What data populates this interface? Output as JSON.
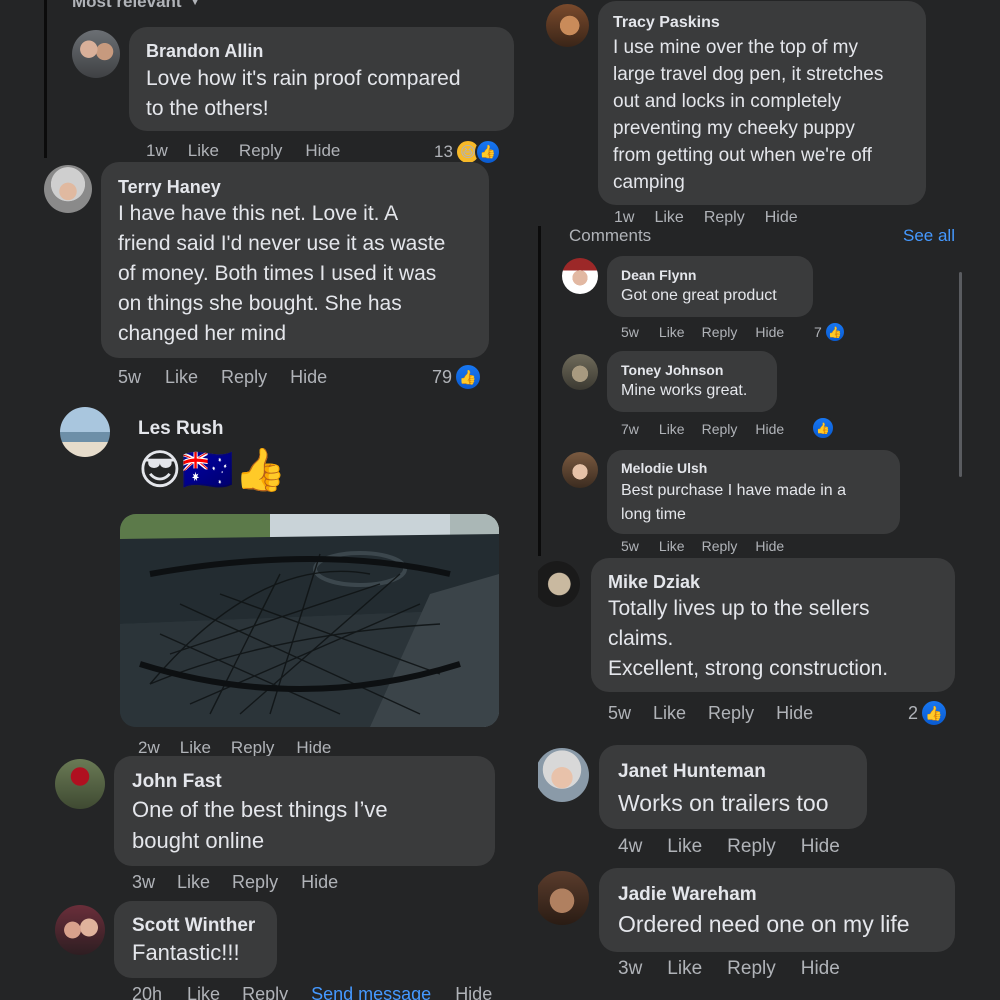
{
  "sort": {
    "label": "Most relevant"
  },
  "left": [
    {
      "name": "Brandon Allin",
      "text": "Love how it's rain proof compared\nto the others!",
      "time": "1w",
      "like": "Like",
      "reply": "Reply",
      "hide": "Hide",
      "count": "13"
    },
    {
      "name": "Terry Haney",
      "text": "I have have this net. Love it. A\nfriend said I'd never use it as waste\nof money. Both times I used it was\non things she bought. She has\nchanged her mind",
      "time": "5w",
      "like": "Like",
      "reply": "Reply",
      "hide": "Hide",
      "count": "79"
    },
    {
      "name": "Les Rush",
      "emojis": "😎🇦🇺👍",
      "time": "2w",
      "like": "Like",
      "reply": "Reply",
      "hide": "Hide"
    },
    {
      "name": "John Fast",
      "text": "One of the best things I’ve\nbought online",
      "time": "3w",
      "like": "Like",
      "reply": "Reply",
      "hide": "Hide"
    },
    {
      "name": "Scott Winther",
      "text": "Fantastic!!!",
      "time": "20h",
      "like": "Like",
      "reply": "Reply",
      "message": "Send message",
      "hide": "Hide"
    }
  ],
  "right_top": {
    "name": "Tracy Paskins",
    "text": "I use mine over the top of my\nlarge travel dog pen, it stretches\nout and locks in completely\npreventing my cheeky puppy\nfrom getting out when we're off\ncamping",
    "time": "1w",
    "like": "Like",
    "reply": "Reply",
    "hide": "Hide"
  },
  "comments_panel": {
    "title": "Comments",
    "see_all": "See all",
    "items": [
      {
        "name": "Dean Flynn",
        "text": "Got one great product",
        "time": "5w",
        "like": "Like",
        "reply": "Reply",
        "hide": "Hide",
        "count": "7"
      },
      {
        "name": "Toney Johnson",
        "text": "Mine works great.",
        "time": "7w",
        "like": "Like",
        "reply": "Reply",
        "hide": "Hide"
      },
      {
        "name": "Melodie Ulsh",
        "text": "Best purchase I have made in a\nlong time",
        "time": "5w",
        "like": "Like",
        "reply": "Reply",
        "hide": "Hide"
      }
    ]
  },
  "right": [
    {
      "name": "Mike Dziak",
      "text": "Totally lives up to the sellers\nclaims.\nExcellent, strong construction.",
      "time": "5w",
      "like": "Like",
      "reply": "Reply",
      "hide": "Hide",
      "count": "2"
    },
    {
      "name": "Janet Hunteman",
      "text": "Works on trailers too",
      "time": "4w",
      "like": "Like",
      "reply": "Reply",
      "hide": "Hide"
    },
    {
      "name": "Jadie Wareham",
      "text": "Ordered need one on my life",
      "time": "3w",
      "like": "Like",
      "reply": "Reply",
      "hide": "Hide"
    }
  ],
  "colors": {
    "background": "#242526",
    "bubble": "#3a3b3c",
    "link": "#4599ff",
    "muted": "#b0b3b8",
    "like_blue": "#1877f2"
  },
  "icons": {
    "like": "thumbs-up-icon",
    "haha": "laughing-face-icon",
    "dropdown": "chevron-down-icon"
  }
}
